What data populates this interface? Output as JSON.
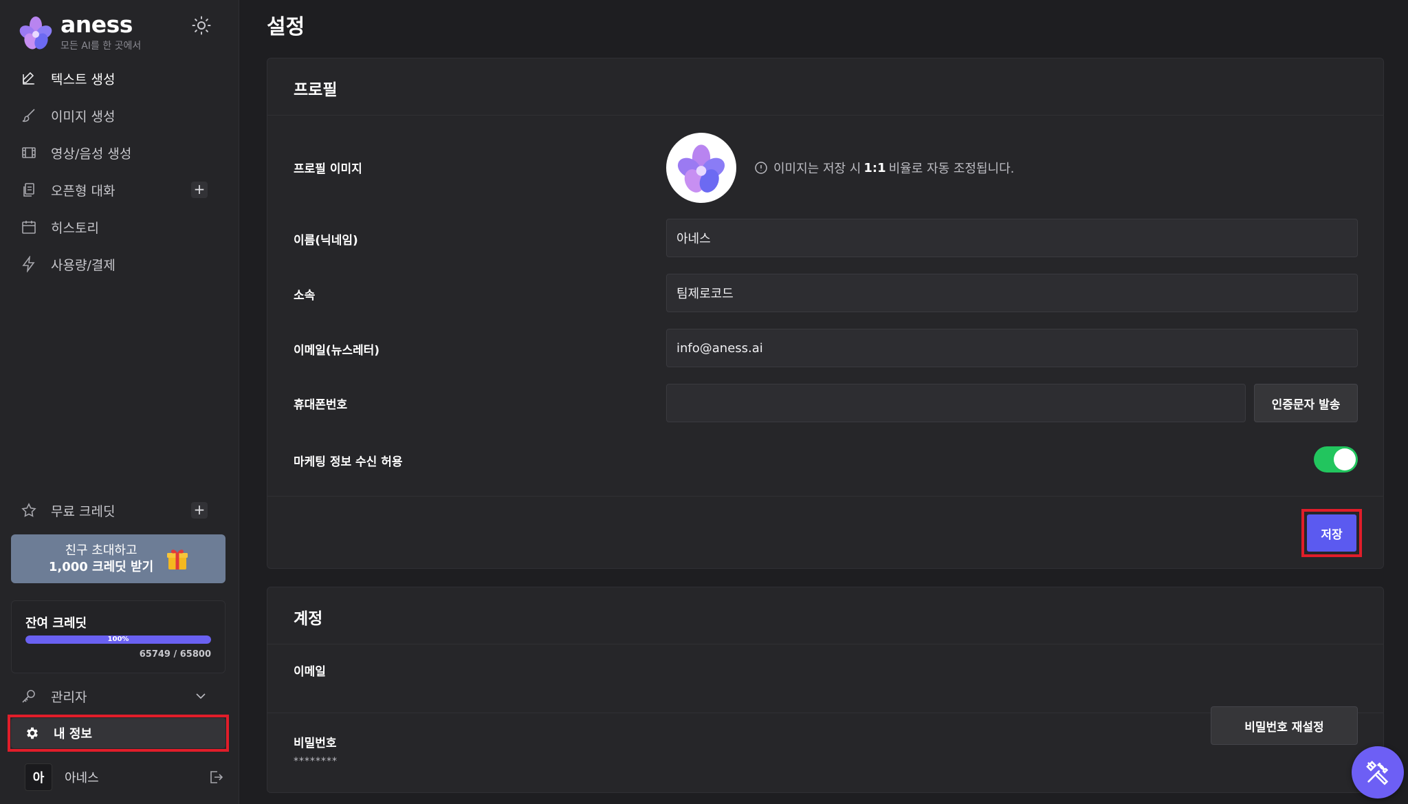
{
  "brand": {
    "name": "aness",
    "tagline": "모든 AI를 한 곳에서"
  },
  "sidebar": {
    "nav": [
      {
        "label": "텍스트 생성",
        "icon": "pencil-square-icon"
      },
      {
        "label": "이미지 생성",
        "icon": "paintbrush-icon"
      },
      {
        "label": "영상/음성 생성",
        "icon": "film-icon"
      },
      {
        "label": "오픈형 대화",
        "icon": "chat-copy-icon"
      },
      {
        "label": "히스토리",
        "icon": "calendar-icon"
      },
      {
        "label": "사용량/결제",
        "icon": "lightning-icon"
      }
    ],
    "free_credit_label": "무료 크레딧",
    "invite": {
      "line1": "친구 초대하고",
      "line2": "1,000 크레딧 받기"
    },
    "credit": {
      "title": "잔여 크레딧",
      "percent_label": "100%",
      "fraction": 1.0,
      "count": "65749 / 65800"
    },
    "admin_label": "관리자",
    "myinfo_label": "내 정보",
    "user": {
      "initial": "아",
      "name": "아네스"
    }
  },
  "main": {
    "page_title": "설정",
    "profile": {
      "title": "프로필",
      "image_label": "프로필 이미지",
      "image_note_pre": "이미지는 저장 시",
      "image_note_ratio": "1:1",
      "image_note_post": "비율로 자동 조정됩니다.",
      "name_label": "이름(닉네임)",
      "name_value": "아네스",
      "org_label": "소속",
      "org_value": "팀제로코드",
      "email_label": "이메일(뉴스레터)",
      "email_value": "info@aness.ai",
      "phone_label": "휴대폰번호",
      "phone_value": "",
      "sms_button": "인증문자 발송",
      "marketing_label": "마케팅 정보 수신 허용",
      "marketing_enabled": true,
      "save_button": "저장"
    },
    "account": {
      "title": "계정",
      "email_label": "이메일",
      "password_label": "비밀번호",
      "password_mask": "********",
      "reset_button": "비밀번호 재설정"
    }
  },
  "colors": {
    "accent": "#5b5af0",
    "toggle_on": "#22c55e",
    "highlight": "#e11d2a",
    "invite_bg": "#6d7d96"
  }
}
